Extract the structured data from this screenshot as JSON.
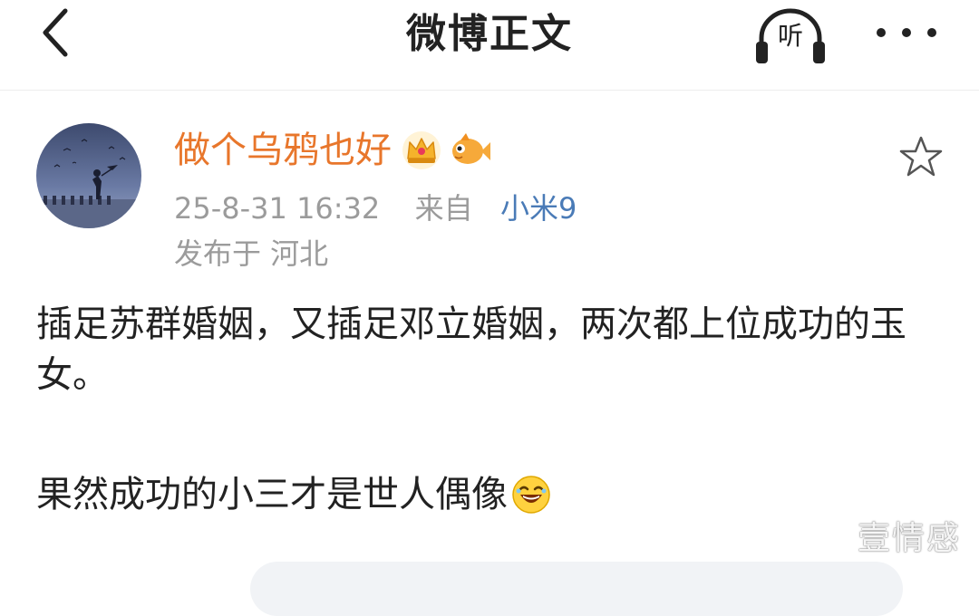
{
  "header": {
    "title": "微博正文",
    "listen_label": "听"
  },
  "post": {
    "username": "做个乌鸦也好",
    "timestamp": "25-8-31 16:32",
    "source_prefix": "来自",
    "device": "小米9",
    "location": "发布于 河北",
    "paragraph1": "插足苏群婚姻，又插足邓立婚姻，两次都上位成功的玉女。",
    "paragraph2": "果然成功的小三才是世人偶像"
  },
  "watermark": "壹情感",
  "icons": {
    "back": "back-chevron-icon",
    "listen": "headphones-icon",
    "more": "more-dots-icon",
    "crown": "crown-badge-icon",
    "fish": "fish-badge-icon",
    "star": "star-outline-icon",
    "emoji": "laughing-emoji-icon"
  },
  "colors": {
    "username": "#e8762b",
    "device_link": "#4a7bb7",
    "meta_gray": "#9b9b9b"
  }
}
